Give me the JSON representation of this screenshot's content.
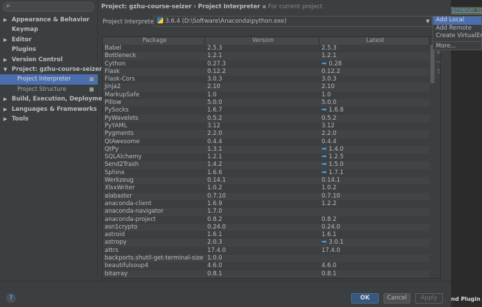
{
  "search": {
    "icon": "search-icon"
  },
  "sidebar": {
    "items": [
      {
        "label": "Appearance & Behavior",
        "arrow": "▶"
      },
      {
        "label": "Keymap",
        "arrow": ""
      },
      {
        "label": "Editor",
        "arrow": "▶"
      },
      {
        "label": "Plugins",
        "arrow": ""
      },
      {
        "label": "Version Control",
        "arrow": "▶"
      },
      {
        "label": "Project: gzhu-course-seizer",
        "arrow": "▼"
      },
      {
        "label": "Project Interpreter"
      },
      {
        "label": "Project Structure"
      },
      {
        "label": "Build, Execution, Deployment",
        "arrow": "▶"
      },
      {
        "label": "Languages & Frameworks",
        "arrow": "▶"
      },
      {
        "label": "Tools",
        "arrow": "▶"
      }
    ]
  },
  "breadcrumb": {
    "project": "Project: gzhu-course-seizer",
    "sep": " › ",
    "page": "Project Interpreter",
    "note": "For current project"
  },
  "interpreter": {
    "label": "Project Interpreter:",
    "value": "3.6.4 (D:\\Software\\Anaconda\\python.exe)"
  },
  "table": {
    "headers": [
      "Package",
      "Version",
      "Latest"
    ],
    "rows": [
      [
        "Babel",
        "2.5.3",
        "2.5.3",
        false
      ],
      [
        "Bottleneck",
        "1.2.1",
        "1.2.1",
        false
      ],
      [
        "Cython",
        "0.27.3",
        "0.28",
        true
      ],
      [
        "Flask",
        "0.12.2",
        "0.12.2",
        false
      ],
      [
        "Flask-Cors",
        "3.0.3",
        "3.0.3",
        false
      ],
      [
        "Jinja2",
        "2.10",
        "2.10",
        false
      ],
      [
        "MarkupSafe",
        "1.0",
        "1.0",
        false
      ],
      [
        "Pillow",
        "5.0.0",
        "5.0.0",
        false
      ],
      [
        "PySocks",
        "1.6.7",
        "1.6.8",
        true
      ],
      [
        "PyWavelets",
        "0.5.2",
        "0.5.2",
        false
      ],
      [
        "PyYAML",
        "3.12",
        "3.12",
        false
      ],
      [
        "Pygments",
        "2.2.0",
        "2.2.0",
        false
      ],
      [
        "QtAwesome",
        "0.4.4",
        "0.4.4",
        false
      ],
      [
        "QtPy",
        "1.3.1",
        "1.4.0",
        true
      ],
      [
        "SQLAlchemy",
        "1.2.1",
        "1.2.5",
        true
      ],
      [
        "Send2Trash",
        "1.4.2",
        "1.5.0",
        true
      ],
      [
        "Sphinx",
        "1.6.6",
        "1.7.1",
        true
      ],
      [
        "Werkzeug",
        "0.14.1",
        "0.14.1",
        false
      ],
      [
        "XlsxWriter",
        "1.0.2",
        "1.0.2",
        false
      ],
      [
        "alabaster",
        "0.7.10",
        "0.7.10",
        false
      ],
      [
        "anaconda-client",
        "1.6.9",
        "1.2.2",
        false
      ],
      [
        "anaconda-navigator",
        "1.7.0",
        "",
        false
      ],
      [
        "anaconda-project",
        "0.8.2",
        "0.8.2",
        false
      ],
      [
        "asn1crypto",
        "0.24.0",
        "0.24.0",
        false
      ],
      [
        "astroid",
        "1.6.1",
        "1.6.1",
        false
      ],
      [
        "astropy",
        "2.0.3",
        "3.0.1",
        true
      ],
      [
        "attrs",
        "17.4.0",
        "17.4.0",
        false
      ],
      [
        "backports.shutil-get-terminal-size",
        "1.0.0",
        "",
        false
      ],
      [
        "beautifulsoup4",
        "4.6.0",
        "4.6.0",
        false
      ],
      [
        "bitarray",
        "0.8.1",
        "0.8.1",
        false
      ]
    ]
  },
  "side_buttons": {
    "add": "+",
    "remove": "−",
    "upgrade": "⇧"
  },
  "menu": {
    "items": [
      "Add Local",
      "Add Remote",
      "Create VirtualEnv",
      "More..."
    ]
  },
  "footer": {
    "help": "?",
    "ok": "OK",
    "cancel": "Cancel",
    "apply": "Apply"
  },
  "background": {
    "link": "browser to J",
    "plugin": "nd Plugin Up"
  }
}
